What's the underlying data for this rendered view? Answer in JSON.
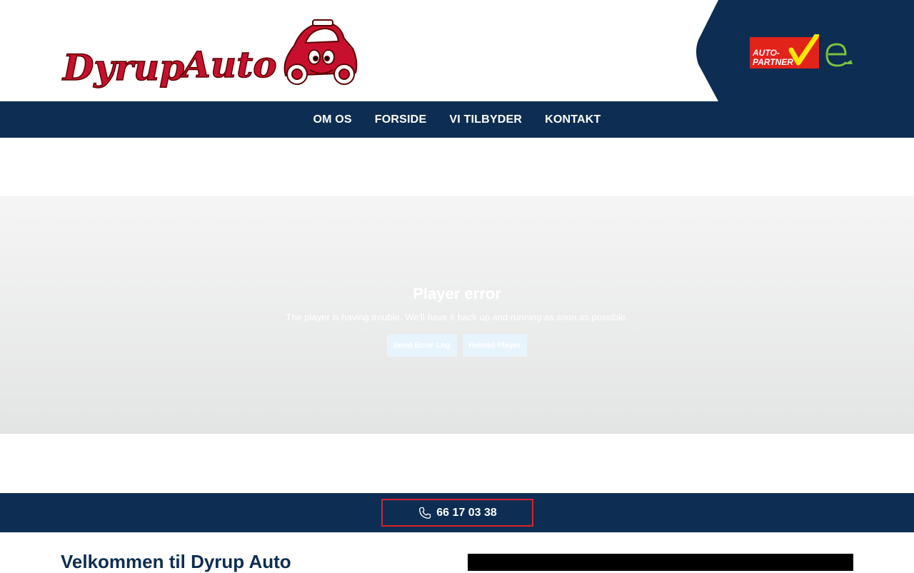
{
  "header": {
    "logo_text": "Dyrup Auto",
    "partner_badge_text": [
      "AUTO-",
      "PARTNER"
    ],
    "e_logo_text": "e"
  },
  "nav": {
    "items": [
      {
        "label": "OM OS"
      },
      {
        "label": "FORSIDE"
      },
      {
        "label": "VI TILBYDER"
      },
      {
        "label": "KONTAKT"
      }
    ]
  },
  "player": {
    "title": "Player error",
    "message": "The player is having trouble. We'll have it back up and running as soon as possible.",
    "send_log_label": "Send Error Log",
    "reload_label": "Reload Player"
  },
  "callbar": {
    "phone": "66 17 03 38"
  },
  "welcome": {
    "heading": "Velkommen til Dyrup Auto"
  },
  "colors": {
    "navy": "#0d2d52",
    "brand_red": "#c8102e",
    "partner_red": "#e2231a",
    "partner_yellow": "#ffe600",
    "e_green": "#7ac143"
  },
  "icons": {
    "phone": "phone-icon",
    "car": "car-mascot-icon"
  }
}
